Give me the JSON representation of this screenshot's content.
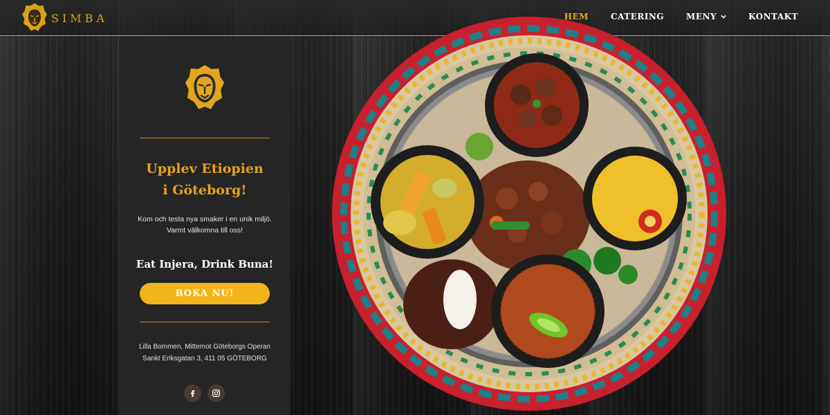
{
  "brand": {
    "name": "SIMBA",
    "logo_icon": "lion-head-icon",
    "color": "#d9a21b"
  },
  "nav": {
    "items": [
      {
        "label": "HEM",
        "active": true
      },
      {
        "label": "CATERING",
        "active": false
      },
      {
        "label": "MENY",
        "active": false,
        "has_dropdown": true
      },
      {
        "label": "KONTAKT",
        "active": false
      }
    ],
    "active_color": "#e7a81b"
  },
  "panel": {
    "logo_icon": "lion-head-icon",
    "headline_line1": "Upplev Etiopien",
    "headline_line2": "i Göteborg!",
    "tagline_line1": "Kom och testa nya smaker i en unik miljö.",
    "tagline_line2": "Varmt välkomna till oss!",
    "slogan": "Eat Injera, Drink Buna!",
    "cta_label": "BOKA NU!",
    "cta_color": "#f2b41b",
    "address_line1": "Lilla Bommen, Mittemot Göteborgs Operan",
    "address_line2": "Sankt Eriksgatan 3, 411 05 GÖTEBORG",
    "socials": [
      {
        "icon": "facebook-icon"
      },
      {
        "icon": "instagram-icon"
      }
    ]
  },
  "hero_image": {
    "subject": "ethiopian-food-platter"
  }
}
